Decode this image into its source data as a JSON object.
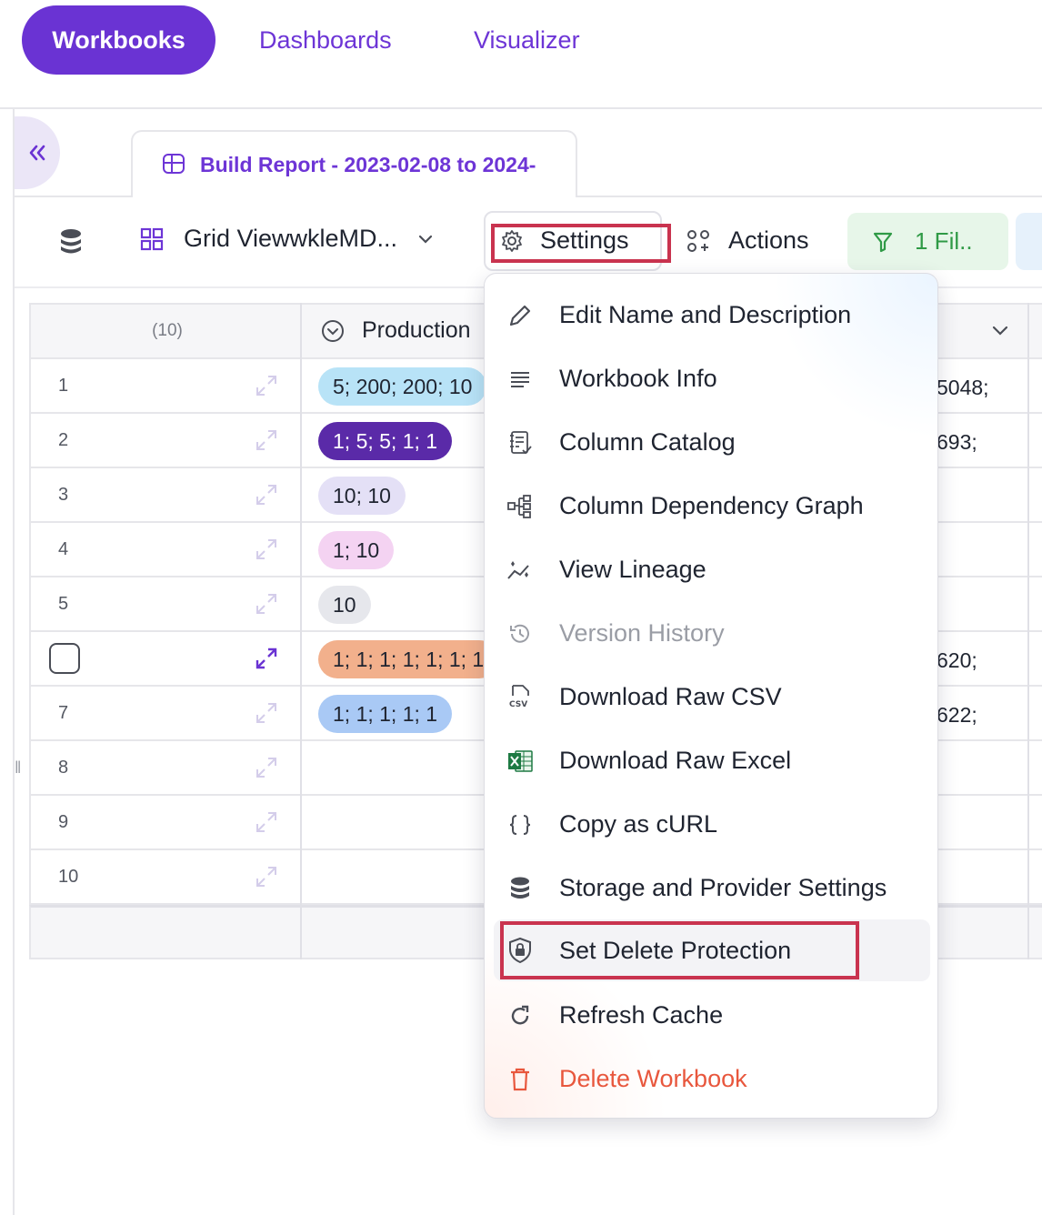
{
  "nav": {
    "tabs": [
      {
        "label": "Workbooks",
        "active": true
      },
      {
        "label": "Dashboards",
        "active": false
      },
      {
        "label": "Visualizer",
        "active": false
      }
    ]
  },
  "report_tab": {
    "label": "Build Report - 2023-02-08 to 2024-"
  },
  "toolbar": {
    "view_name": "Grid ViewwkleMD...",
    "settings_label": "Settings",
    "actions_label": "Actions",
    "filter_label": "1 Fil.."
  },
  "grid": {
    "row_count_label": "(10)",
    "column_header": "Production",
    "rows": [
      {
        "num": "1",
        "pill": "5; 200; 200; 10",
        "right": "5048;"
      },
      {
        "num": "2",
        "pill": "1; 5; 5; 1; 1",
        "right": "693;"
      },
      {
        "num": "3",
        "pill": "10; 10",
        "right": ""
      },
      {
        "num": "4",
        "pill": "1; 10",
        "right": ""
      },
      {
        "num": "5",
        "pill": "10",
        "right": ""
      },
      {
        "num": "",
        "pill": "1; 1; 1; 1; 1; 1; 1",
        "right": "620;"
      },
      {
        "num": "7",
        "pill": "1; 1; 1; 1; 1",
        "right": "622;"
      },
      {
        "num": "8",
        "pill": "",
        "right": ""
      },
      {
        "num": "9",
        "pill": "",
        "right": ""
      },
      {
        "num": "10",
        "pill": "",
        "right": ""
      }
    ]
  },
  "settings_menu": {
    "items": [
      {
        "label": "Edit Name and Description",
        "icon": "pencil-icon"
      },
      {
        "label": "Workbook Info",
        "icon": "lines-icon"
      },
      {
        "label": "Column Catalog",
        "icon": "catalog-icon"
      },
      {
        "label": "Column Dependency Graph",
        "icon": "dependency-graph-icon"
      },
      {
        "label": "View Lineage",
        "icon": "lineage-icon"
      },
      {
        "label": "Version History",
        "icon": "history-icon",
        "disabled": true
      },
      {
        "label": "Download Raw CSV",
        "icon": "csv-file-icon"
      },
      {
        "label": "Download Raw Excel",
        "icon": "excel-icon"
      },
      {
        "label": "Copy as cURL",
        "icon": "braces-icon"
      },
      {
        "label": "Storage and Provider Settings",
        "icon": "database-icon"
      },
      {
        "label": "Set Delete Protection",
        "icon": "shield-lock-icon",
        "highlighted": true
      },
      {
        "label": "Refresh Cache",
        "icon": "refresh-icon"
      },
      {
        "label": "Delete Workbook",
        "icon": "trash-icon",
        "danger": true
      }
    ]
  },
  "colors": {
    "brand": "#6a33d3",
    "highlight": "#c9334f",
    "danger": "#e8573d",
    "filter_green": "#2f9a46"
  }
}
